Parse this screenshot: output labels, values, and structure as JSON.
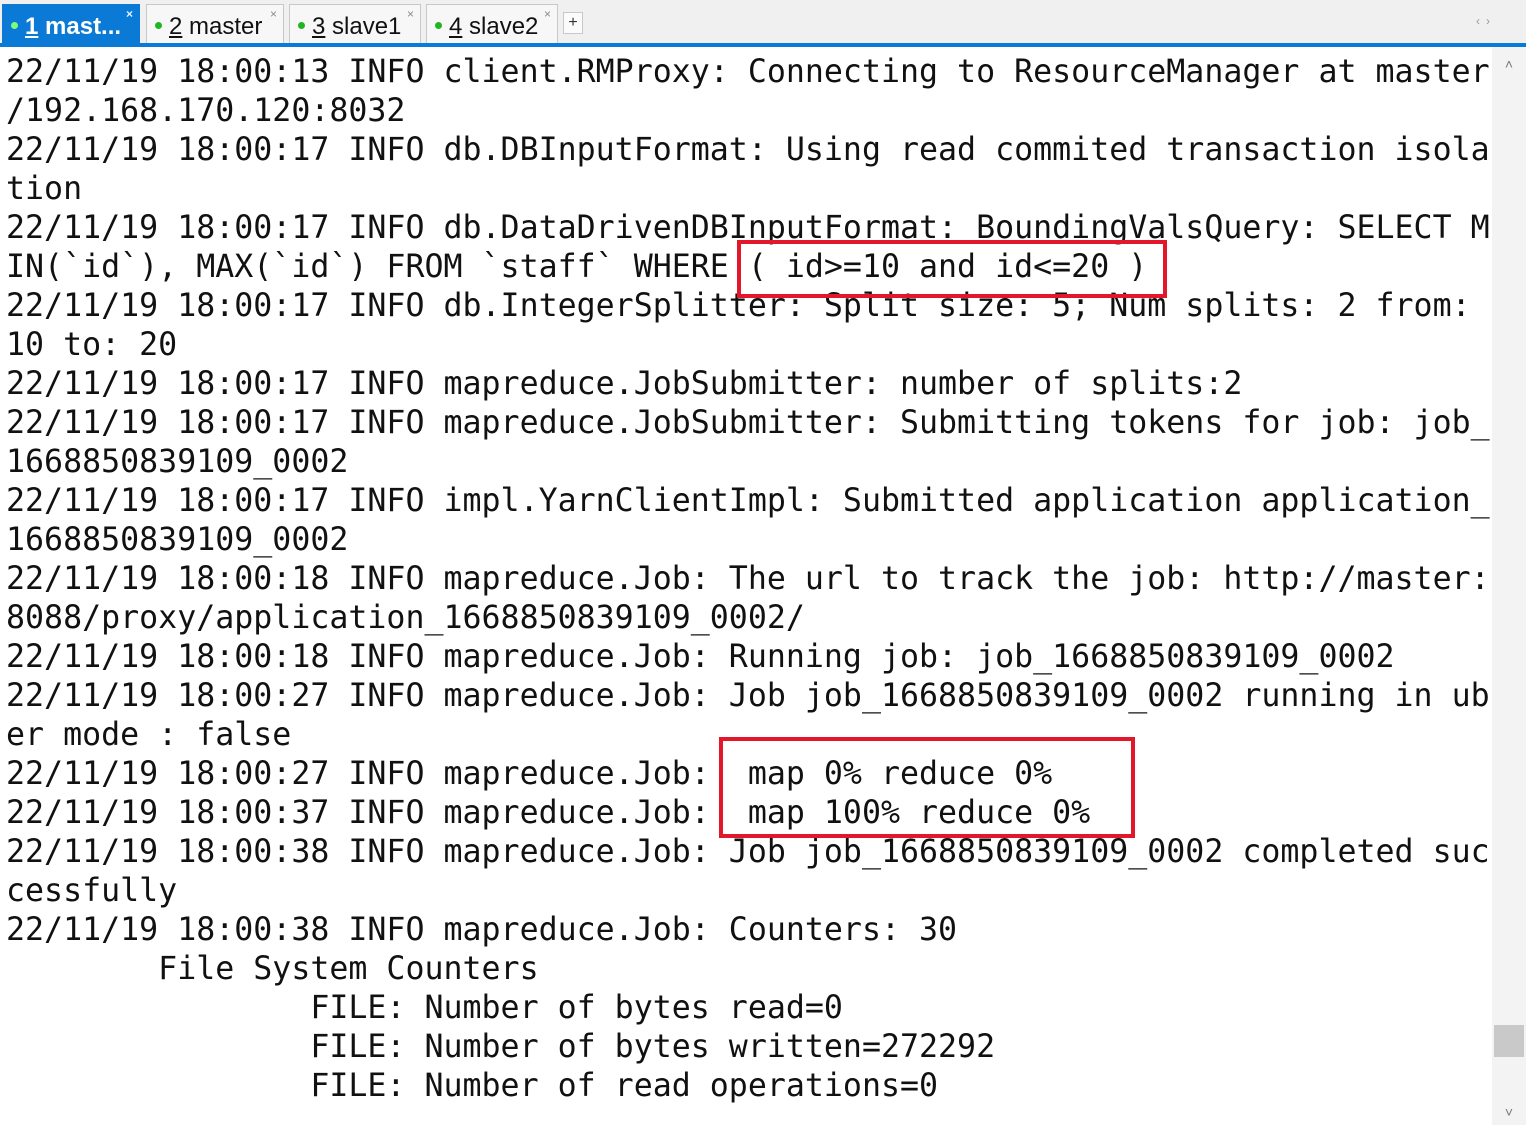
{
  "tabs": [
    {
      "number": "1",
      "label": "mast...",
      "close": "×"
    },
    {
      "number": "2",
      "label": "master",
      "close": "×"
    },
    {
      "number": "3",
      "label": "slave1",
      "close": "×"
    },
    {
      "number": "4",
      "label": "slave2",
      "close": "×"
    }
  ],
  "new_tab_label": "+",
  "nav_arrows": "‹›",
  "scroll": {
    "up": "˄",
    "down": "˅"
  },
  "colors": {
    "accent": "#0a7ad6",
    "highlight": "#e3172b",
    "status_dot": "#1fb61f"
  },
  "terminal": {
    "lines": [
      "22/11/19 18:00:13 INFO client.RMProxy: Connecting to ResourceManager at master",
      "/192.168.170.120:8032",
      "22/11/19 18:00:17 INFO db.DBInputFormat: Using read commited transaction isola",
      "tion",
      "22/11/19 18:00:17 INFO db.DataDrivenDBInputFormat: BoundingValsQuery: SELECT M",
      "IN(`id`), MAX(`id`) FROM `staff` WHERE ( id>=10 and id<=20 )",
      "22/11/19 18:00:17 INFO db.IntegerSplitter: Split size: 5; Num splits: 2 from:",
      "10 to: 20",
      "22/11/19 18:00:17 INFO mapreduce.JobSubmitter: number of splits:2",
      "22/11/19 18:00:17 INFO mapreduce.JobSubmitter: Submitting tokens for job: job_",
      "1668850839109_0002",
      "22/11/19 18:00:17 INFO impl.YarnClientImpl: Submitted application application_",
      "1668850839109_0002",
      "22/11/19 18:00:18 INFO mapreduce.Job: The url to track the job: http://master:",
      "8088/proxy/application_1668850839109_0002/",
      "22/11/19 18:00:18 INFO mapreduce.Job: Running job: job_1668850839109_0002",
      "22/11/19 18:00:27 INFO mapreduce.Job: Job job_1668850839109_0002 running in ub",
      "er mode : false",
      "22/11/19 18:00:27 INFO mapreduce.Job:  map 0% reduce 0%",
      "22/11/19 18:00:37 INFO mapreduce.Job:  map 100% reduce 0%",
      "22/11/19 18:00:38 INFO mapreduce.Job: Job job_1668850839109_0002 completed suc",
      "cessfully",
      "22/11/19 18:00:38 INFO mapreduce.Job: Counters: 30",
      "        File System Counters",
      "                FILE: Number of bytes read=0",
      "                FILE: Number of bytes written=272292",
      "                FILE: Number of read operations=0"
    ]
  }
}
